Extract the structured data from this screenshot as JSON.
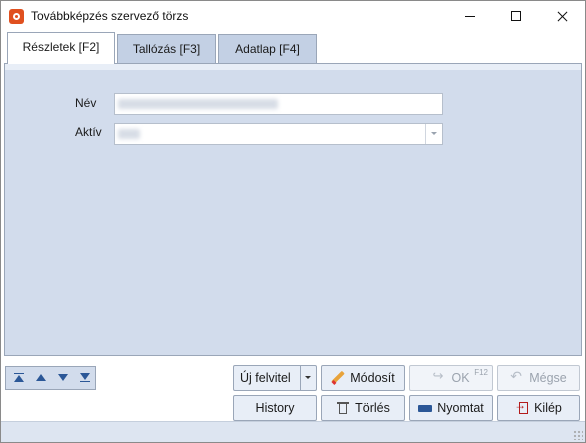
{
  "window": {
    "title": "Továbbképzés szervező törzs"
  },
  "tabs": [
    {
      "label": "Részletek [F2]",
      "active": true
    },
    {
      "label": "Tallózás [F3]",
      "active": false
    },
    {
      "label": "Adatlap [F4]",
      "active": false
    }
  ],
  "form": {
    "nev_label": "Név",
    "aktiv_label": "Aktív"
  },
  "buttons": {
    "uj_felvitel": "Új felvitel",
    "modosit": "Módosít",
    "ok": "OK",
    "ok_shortcut": "F12",
    "megse": "Mégse",
    "history": "History",
    "torles": "Törlés",
    "nyomtat": "Nyomtat",
    "kilep": "Kilép"
  },
  "colors": {
    "accent": "#2b5797",
    "panel": "#d2dcec",
    "tab_inactive": "#c3d0e4"
  },
  "icons": {
    "app": "app-logo-icon",
    "nav": [
      "first-record-icon",
      "prev-record-icon",
      "next-record-icon",
      "last-record-icon"
    ]
  }
}
